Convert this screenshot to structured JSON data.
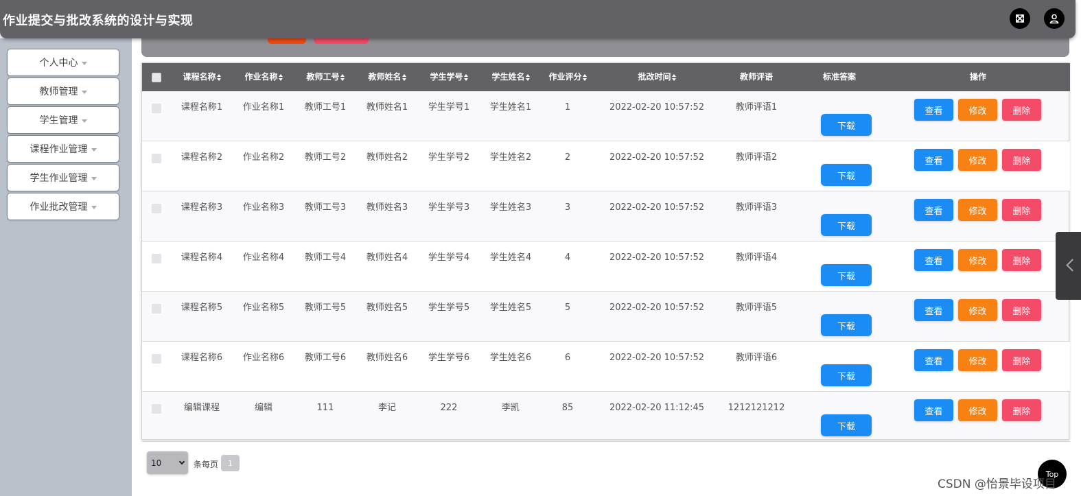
{
  "header": {
    "title": "作业提交与批改系统的设计与实现",
    "icons": [
      "fullscreen-icon",
      "user-icon"
    ]
  },
  "sidebar": {
    "items": [
      {
        "label": "个人中心"
      },
      {
        "label": "教师管理"
      },
      {
        "label": "学生管理"
      },
      {
        "label": "课程作业管理"
      },
      {
        "label": "学生作业管理"
      },
      {
        "label": "作业批改管理"
      }
    ]
  },
  "table": {
    "columns": [
      "课程名称",
      "作业名称",
      "教师工号",
      "教师姓名",
      "学生学号",
      "学生姓名",
      "作业评分",
      "批改时间",
      "教师评语",
      "标准答案",
      "操作"
    ],
    "rows": [
      {
        "course": "课程名称1",
        "work": "作业名称1",
        "tid": "教师工号1",
        "tname": "教师姓名1",
        "sid": "学生学号1",
        "sname": "学生姓名1",
        "score": "1",
        "time": "2022-02-20 10:57:52",
        "comment": "教师评语1"
      },
      {
        "course": "课程名称2",
        "work": "作业名称2",
        "tid": "教师工号2",
        "tname": "教师姓名2",
        "sid": "学生学号2",
        "sname": "学生姓名2",
        "score": "2",
        "time": "2022-02-20 10:57:52",
        "comment": "教师评语2"
      },
      {
        "course": "课程名称3",
        "work": "作业名称3",
        "tid": "教师工号3",
        "tname": "教师姓名3",
        "sid": "学生学号3",
        "sname": "学生姓名3",
        "score": "3",
        "time": "2022-02-20 10:57:52",
        "comment": "教师评语3"
      },
      {
        "course": "课程名称4",
        "work": "作业名称4",
        "tid": "教师工号4",
        "tname": "教师姓名4",
        "sid": "学生学号4",
        "sname": "学生姓名4",
        "score": "4",
        "time": "2022-02-20 10:57:52",
        "comment": "教师评语4"
      },
      {
        "course": "课程名称5",
        "work": "作业名称5",
        "tid": "教师工号5",
        "tname": "教师姓名5",
        "sid": "学生学号5",
        "sname": "学生姓名5",
        "score": "5",
        "time": "2022-02-20 10:57:52",
        "comment": "教师评语5"
      },
      {
        "course": "课程名称6",
        "work": "作业名称6",
        "tid": "教师工号6",
        "tname": "教师姓名6",
        "sid": "学生学号6",
        "sname": "学生姓名6",
        "score": "6",
        "time": "2022-02-20 10:57:52",
        "comment": "教师评语6"
      },
      {
        "course": "编辑课程",
        "work": "编辑",
        "tid": "111",
        "tname": "李记",
        "sid": "222",
        "sname": "李凯",
        "score": "85",
        "time": "2022-02-20 11:12:45",
        "comment": "1212121212"
      }
    ],
    "actions": {
      "download": "下载",
      "view": "查看",
      "edit": "修改",
      "delete": "删除"
    }
  },
  "pagination": {
    "page_size": "10",
    "per_page_label": "条每页",
    "current_page": "1"
  },
  "top_button": "Top",
  "watermark": "CSDN @怡景毕设项目",
  "colors": {
    "header": "#626266",
    "sidebar": "#bac1ca",
    "view": "#1a8cf4",
    "edit": "#f78112",
    "delete": "#f34b68"
  }
}
